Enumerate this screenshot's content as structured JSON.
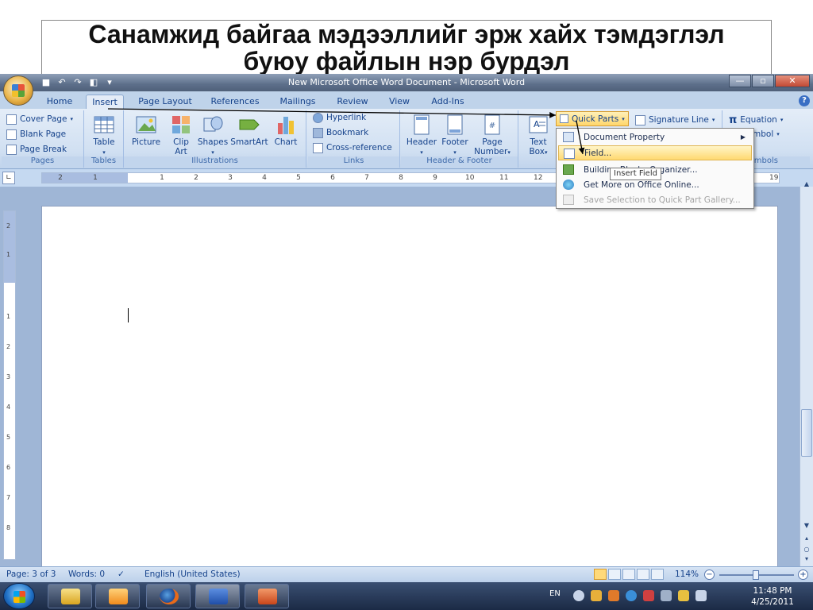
{
  "caption": {
    "line1": "Санамжид байгаа мэдээллийг эрж хайх тэмдэглэл",
    "line2": "буюу файлын нэр бурдэл"
  },
  "window": {
    "title": "New Microsoft Office Word Document - Microsoft Word"
  },
  "tabs": [
    "Home",
    "Insert",
    "Page Layout",
    "References",
    "Mailings",
    "Review",
    "View",
    "Add-Ins"
  ],
  "ribbon": {
    "pages": {
      "label": "Pages",
      "cover": "Cover Page",
      "blank": "Blank Page",
      "break": "Page Break"
    },
    "tables": {
      "label": "Tables",
      "table": "Table"
    },
    "illustrations": {
      "label": "Illustrations",
      "picture": "Picture",
      "clipart1": "Clip",
      "clipart2": "Art",
      "shapes": "Shapes",
      "smartart": "SmartArt",
      "chart": "Chart"
    },
    "links": {
      "label": "Links",
      "hyperlink": "Hyperlink",
      "bookmark": "Bookmark",
      "crossref": "Cross-reference"
    },
    "headerfooter": {
      "label": "Header & Footer",
      "header": "Header",
      "footer": "Footer",
      "pagenum1": "Page",
      "pagenum2": "Number"
    },
    "text": {
      "textbox1": "Text",
      "textbox2": "Box",
      "quickparts": "Quick Parts",
      "sigline": "Signature Line"
    },
    "symbols": {
      "label": "mbols",
      "equation": "Equation",
      "symbol": "mbol"
    }
  },
  "menu": {
    "items": [
      "Document Property",
      "Field...",
      "Building Blocks Organizer...",
      "Get More on Office Online...",
      "Save Selection to Quick Part Gallery..."
    ],
    "tooltip": "Insert Field"
  },
  "ruler": {
    "ticks": [
      "2",
      "1",
      "1",
      "2",
      "3",
      "4",
      "5",
      "6",
      "7",
      "8",
      "9",
      "10",
      "11",
      "12",
      "19"
    ]
  },
  "vruler": {
    "ticks": [
      "2",
      "1",
      "1",
      "2",
      "3",
      "4",
      "5",
      "6",
      "7",
      "8"
    ]
  },
  "status": {
    "page": "Page: 3 of 3",
    "words": "Words: 0",
    "language": "English (United States)",
    "zoom": "114%"
  },
  "taskbar": {
    "lang": "EN",
    "time": "11:48 PM",
    "date": "4/25/2011"
  },
  "colors": {
    "accent": "#15428b",
    "highlight": "#ffd970",
    "ribbon": "#d1e0f2"
  }
}
